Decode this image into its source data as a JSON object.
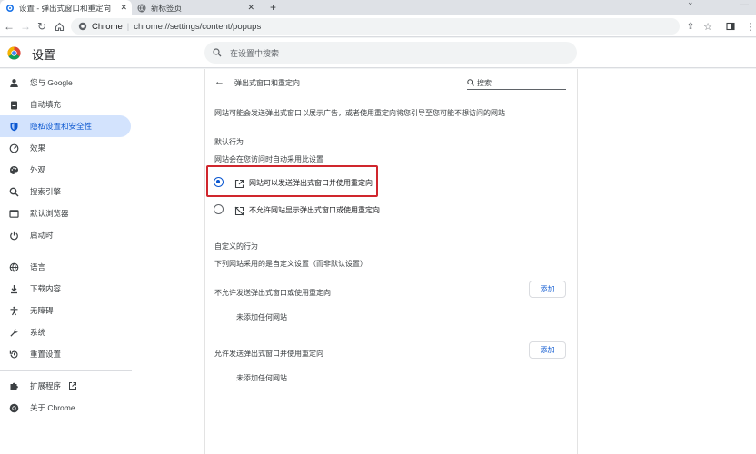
{
  "tabs": [
    {
      "title": "设置 - 弹出式窗口和重定向",
      "active": true,
      "close": "✕"
    },
    {
      "title": "新标签页",
      "active": false,
      "close": "✕"
    }
  ],
  "new_tab": "+",
  "toolbar": {
    "url_site": "Chrome",
    "url_separator": "|",
    "url_path": "chrome://settings/content/popups"
  },
  "header": {
    "title": "设置",
    "search_placeholder": "在设置中搜索"
  },
  "sidebar": {
    "items": [
      {
        "label": "您与 Google",
        "icon": "person-icon"
      },
      {
        "label": "自动填充",
        "icon": "clipboard-icon"
      },
      {
        "label": "隐私设置和安全性",
        "icon": "shield-icon",
        "active": true
      },
      {
        "label": "效果",
        "icon": "gauge-icon"
      },
      {
        "label": "外观",
        "icon": "palette-icon"
      },
      {
        "label": "搜索引擎",
        "icon": "search-icon"
      },
      {
        "label": "默认浏览器",
        "icon": "browser-icon"
      },
      {
        "label": "启动时",
        "icon": "power-icon"
      },
      {
        "label": "语言",
        "icon": "globe-icon"
      },
      {
        "label": "下载内容",
        "icon": "download-icon"
      },
      {
        "label": "无障碍",
        "icon": "accessibility-icon"
      },
      {
        "label": "系统",
        "icon": "wrench-icon"
      },
      {
        "label": "重置设置",
        "icon": "reset-icon"
      },
      {
        "label": "扩展程序",
        "icon": "puzzle-icon"
      },
      {
        "label": "关于 Chrome",
        "icon": "chrome-icon"
      }
    ]
  },
  "main": {
    "page_title": "弹出式窗口和重定向",
    "search_placeholder": "搜索",
    "description": "网站可能会发送弹出式窗口以展示广告，或者使用重定向将您引导至您可能不想访问的网站",
    "default_behavior_heading": "默认行为",
    "default_behavior_desc": "网站会在您访问时自动采用此设置",
    "options": [
      {
        "label": "网站可以发送弹出式窗口并使用重定向",
        "selected": true,
        "icon": "open-in-new-icon"
      },
      {
        "label": "不允许网站显示弹出式窗口或使用重定向",
        "selected": false,
        "icon": "popup-blocked-icon"
      }
    ],
    "custom_heading": "自定义的行为",
    "custom_desc": "下列网站采用的是自定义设置（而非默认设置）",
    "block_section": {
      "title": "不允许发送弹出式窗口或使用重定向",
      "add": "添加",
      "empty": "未添加任何网站"
    },
    "allow_section": {
      "title": "允许发送弹出式窗口并使用重定向",
      "add": "添加",
      "empty": "未添加任何网站"
    }
  },
  "colors": {
    "accent": "#0b57d0",
    "highlight_box": "#d0262d",
    "active_nav_bg": "#d3e3fd"
  }
}
